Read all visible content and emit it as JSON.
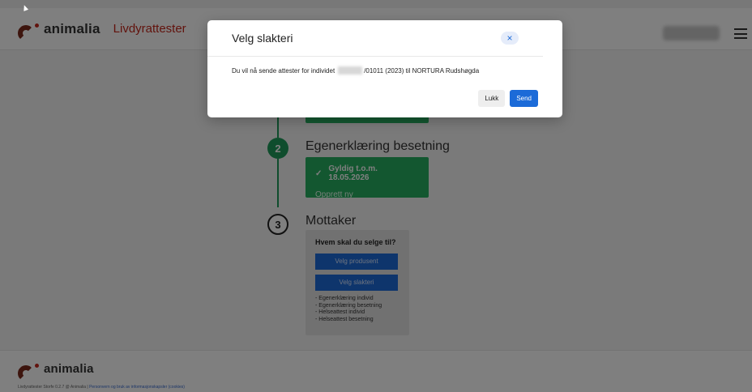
{
  "header": {
    "logo_text": "animalia",
    "app_name": "Livdyrattester"
  },
  "steps": [
    {
      "number": "2",
      "title": "Egenerklæring besetning",
      "valid_text": "Gyldig t.o.m. 18.05.2026",
      "link_text": "Opprett ny"
    },
    {
      "number": "3",
      "title": "Mottaker",
      "question": "Hvem skal du selge til?",
      "buttons": [
        "Velg produsent",
        "Velg slakteri"
      ],
      "docs": [
        "- Egenerklæring individ",
        "- Egenerklæring besetning",
        "- Helseattest individ",
        "- Helseattest besetning"
      ]
    }
  ],
  "footer": {
    "logo_text": "animalia",
    "meta_prefix": "Livdyrattester Storfe 0.2.7 @ Animalia |",
    "meta_link": "Personvern og bruk av informasjonskapsler (cookies)"
  },
  "modal": {
    "title": "Velg slakteri",
    "close_icon": "×",
    "body_prefix": "Du vil nå sende attester for individet",
    "body_suffix": "/01011 (2023) til NORTURA Rudshøgda",
    "close_label": "Lukk",
    "send_label": "Send"
  },
  "colors": {
    "brand_red": "#c4261b",
    "success_green": "#27ae60",
    "primary_blue": "#1c6bd8"
  }
}
